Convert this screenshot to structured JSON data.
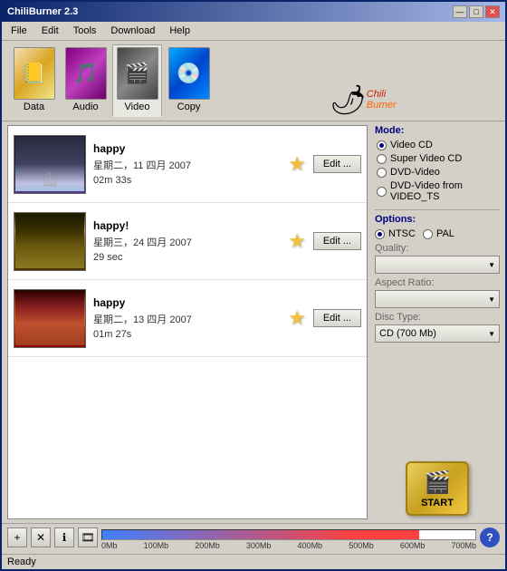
{
  "window": {
    "title": "ChiliBurner 2.3",
    "title_btn_min": "—",
    "title_btn_max": "□",
    "title_btn_close": "✕"
  },
  "menu": {
    "items": [
      "File",
      "Edit",
      "Tools",
      "Download",
      "Help"
    ]
  },
  "tabs": [
    {
      "id": "data",
      "label": "Data",
      "icon": "📁",
      "active": false
    },
    {
      "id": "audio",
      "label": "Audio",
      "icon": "🎵",
      "active": false
    },
    {
      "id": "video",
      "label": "Video",
      "icon": "🎬",
      "active": true
    },
    {
      "id": "copy",
      "label": "Copy",
      "icon": "💿",
      "active": false
    }
  ],
  "logo": {
    "chili": "Chili",
    "burner": "Burner",
    "pepper_icon": "🌶"
  },
  "videos": [
    {
      "id": 1,
      "title": "happy",
      "date": "星期二，11 四月 2007",
      "duration": "02m 33s",
      "thumb_class": "thumb1",
      "edit_label": "Edit ..."
    },
    {
      "id": 2,
      "title": "happy!",
      "date": "星期三，24 四月 2007",
      "duration": "29 sec",
      "thumb_class": "thumb2",
      "edit_label": "Edit ..."
    },
    {
      "id": 3,
      "title": "happy",
      "date": "星期二，13 四月 2007",
      "duration": "01m 27s",
      "thumb_class": "thumb3",
      "edit_label": "Edit ..."
    }
  ],
  "right_panel": {
    "mode_title": "Mode:",
    "modes": [
      {
        "label": "Video CD",
        "checked": true
      },
      {
        "label": "Super Video CD",
        "checked": false
      },
      {
        "label": "DVD-Video",
        "checked": false
      },
      {
        "label": "DVD-Video from VIDEO_TS",
        "checked": false
      }
    ],
    "options_title": "Options:",
    "ntsc_label": "NTSC",
    "pal_label": "PAL",
    "ntsc_checked": true,
    "quality_label": "Quality:",
    "aspect_ratio_label": "Aspect Ratio:",
    "disc_type_label": "Disc Type:",
    "disc_type_value": "CD (700 Mb)",
    "start_label": "START"
  },
  "bottom": {
    "btn_add_icon": "+",
    "btn_remove_icon": "✕",
    "btn_info_icon": "ℹ",
    "btn_film_icon": "🎞",
    "help_icon": "?",
    "progress_labels": [
      "0Mb",
      "100Mb",
      "200Mb",
      "300Mb",
      "400Mb",
      "500Mb",
      "600Mb",
      "700Mb"
    ]
  },
  "status": {
    "text": "Ready"
  }
}
